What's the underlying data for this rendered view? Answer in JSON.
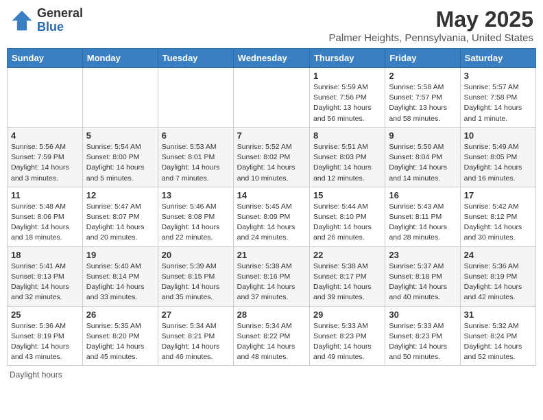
{
  "header": {
    "logo": {
      "line1": "General",
      "line2": "Blue"
    },
    "month": "May 2025",
    "location": "Palmer Heights, Pennsylvania, United States"
  },
  "weekdays": [
    "Sunday",
    "Monday",
    "Tuesday",
    "Wednesday",
    "Thursday",
    "Friday",
    "Saturday"
  ],
  "weeks": [
    [
      {
        "day": "",
        "info": ""
      },
      {
        "day": "",
        "info": ""
      },
      {
        "day": "",
        "info": ""
      },
      {
        "day": "",
        "info": ""
      },
      {
        "day": "1",
        "info": "Sunrise: 5:59 AM\nSunset: 7:56 PM\nDaylight: 13 hours\nand 56 minutes."
      },
      {
        "day": "2",
        "info": "Sunrise: 5:58 AM\nSunset: 7:57 PM\nDaylight: 13 hours\nand 58 minutes."
      },
      {
        "day": "3",
        "info": "Sunrise: 5:57 AM\nSunset: 7:58 PM\nDaylight: 14 hours\nand 1 minute."
      }
    ],
    [
      {
        "day": "4",
        "info": "Sunrise: 5:56 AM\nSunset: 7:59 PM\nDaylight: 14 hours\nand 3 minutes."
      },
      {
        "day": "5",
        "info": "Sunrise: 5:54 AM\nSunset: 8:00 PM\nDaylight: 14 hours\nand 5 minutes."
      },
      {
        "day": "6",
        "info": "Sunrise: 5:53 AM\nSunset: 8:01 PM\nDaylight: 14 hours\nand 7 minutes."
      },
      {
        "day": "7",
        "info": "Sunrise: 5:52 AM\nSunset: 8:02 PM\nDaylight: 14 hours\nand 10 minutes."
      },
      {
        "day": "8",
        "info": "Sunrise: 5:51 AM\nSunset: 8:03 PM\nDaylight: 14 hours\nand 12 minutes."
      },
      {
        "day": "9",
        "info": "Sunrise: 5:50 AM\nSunset: 8:04 PM\nDaylight: 14 hours\nand 14 minutes."
      },
      {
        "day": "10",
        "info": "Sunrise: 5:49 AM\nSunset: 8:05 PM\nDaylight: 14 hours\nand 16 minutes."
      }
    ],
    [
      {
        "day": "11",
        "info": "Sunrise: 5:48 AM\nSunset: 8:06 PM\nDaylight: 14 hours\nand 18 minutes."
      },
      {
        "day": "12",
        "info": "Sunrise: 5:47 AM\nSunset: 8:07 PM\nDaylight: 14 hours\nand 20 minutes."
      },
      {
        "day": "13",
        "info": "Sunrise: 5:46 AM\nSunset: 8:08 PM\nDaylight: 14 hours\nand 22 minutes."
      },
      {
        "day": "14",
        "info": "Sunrise: 5:45 AM\nSunset: 8:09 PM\nDaylight: 14 hours\nand 24 minutes."
      },
      {
        "day": "15",
        "info": "Sunrise: 5:44 AM\nSunset: 8:10 PM\nDaylight: 14 hours\nand 26 minutes."
      },
      {
        "day": "16",
        "info": "Sunrise: 5:43 AM\nSunset: 8:11 PM\nDaylight: 14 hours\nand 28 minutes."
      },
      {
        "day": "17",
        "info": "Sunrise: 5:42 AM\nSunset: 8:12 PM\nDaylight: 14 hours\nand 30 minutes."
      }
    ],
    [
      {
        "day": "18",
        "info": "Sunrise: 5:41 AM\nSunset: 8:13 PM\nDaylight: 14 hours\nand 32 minutes."
      },
      {
        "day": "19",
        "info": "Sunrise: 5:40 AM\nSunset: 8:14 PM\nDaylight: 14 hours\nand 33 minutes."
      },
      {
        "day": "20",
        "info": "Sunrise: 5:39 AM\nSunset: 8:15 PM\nDaylight: 14 hours\nand 35 minutes."
      },
      {
        "day": "21",
        "info": "Sunrise: 5:38 AM\nSunset: 8:16 PM\nDaylight: 14 hours\nand 37 minutes."
      },
      {
        "day": "22",
        "info": "Sunrise: 5:38 AM\nSunset: 8:17 PM\nDaylight: 14 hours\nand 39 minutes."
      },
      {
        "day": "23",
        "info": "Sunrise: 5:37 AM\nSunset: 8:18 PM\nDaylight: 14 hours\nand 40 minutes."
      },
      {
        "day": "24",
        "info": "Sunrise: 5:36 AM\nSunset: 8:19 PM\nDaylight: 14 hours\nand 42 minutes."
      }
    ],
    [
      {
        "day": "25",
        "info": "Sunrise: 5:36 AM\nSunset: 8:19 PM\nDaylight: 14 hours\nand 43 minutes."
      },
      {
        "day": "26",
        "info": "Sunrise: 5:35 AM\nSunset: 8:20 PM\nDaylight: 14 hours\nand 45 minutes."
      },
      {
        "day": "27",
        "info": "Sunrise: 5:34 AM\nSunset: 8:21 PM\nDaylight: 14 hours\nand 46 minutes."
      },
      {
        "day": "28",
        "info": "Sunrise: 5:34 AM\nSunset: 8:22 PM\nDaylight: 14 hours\nand 48 minutes."
      },
      {
        "day": "29",
        "info": "Sunrise: 5:33 AM\nSunset: 8:23 PM\nDaylight: 14 hours\nand 49 minutes."
      },
      {
        "day": "30",
        "info": "Sunrise: 5:33 AM\nSunset: 8:23 PM\nDaylight: 14 hours\nand 50 minutes."
      },
      {
        "day": "31",
        "info": "Sunrise: 5:32 AM\nSunset: 8:24 PM\nDaylight: 14 hours\nand 52 minutes."
      }
    ]
  ],
  "footer": "Daylight hours"
}
